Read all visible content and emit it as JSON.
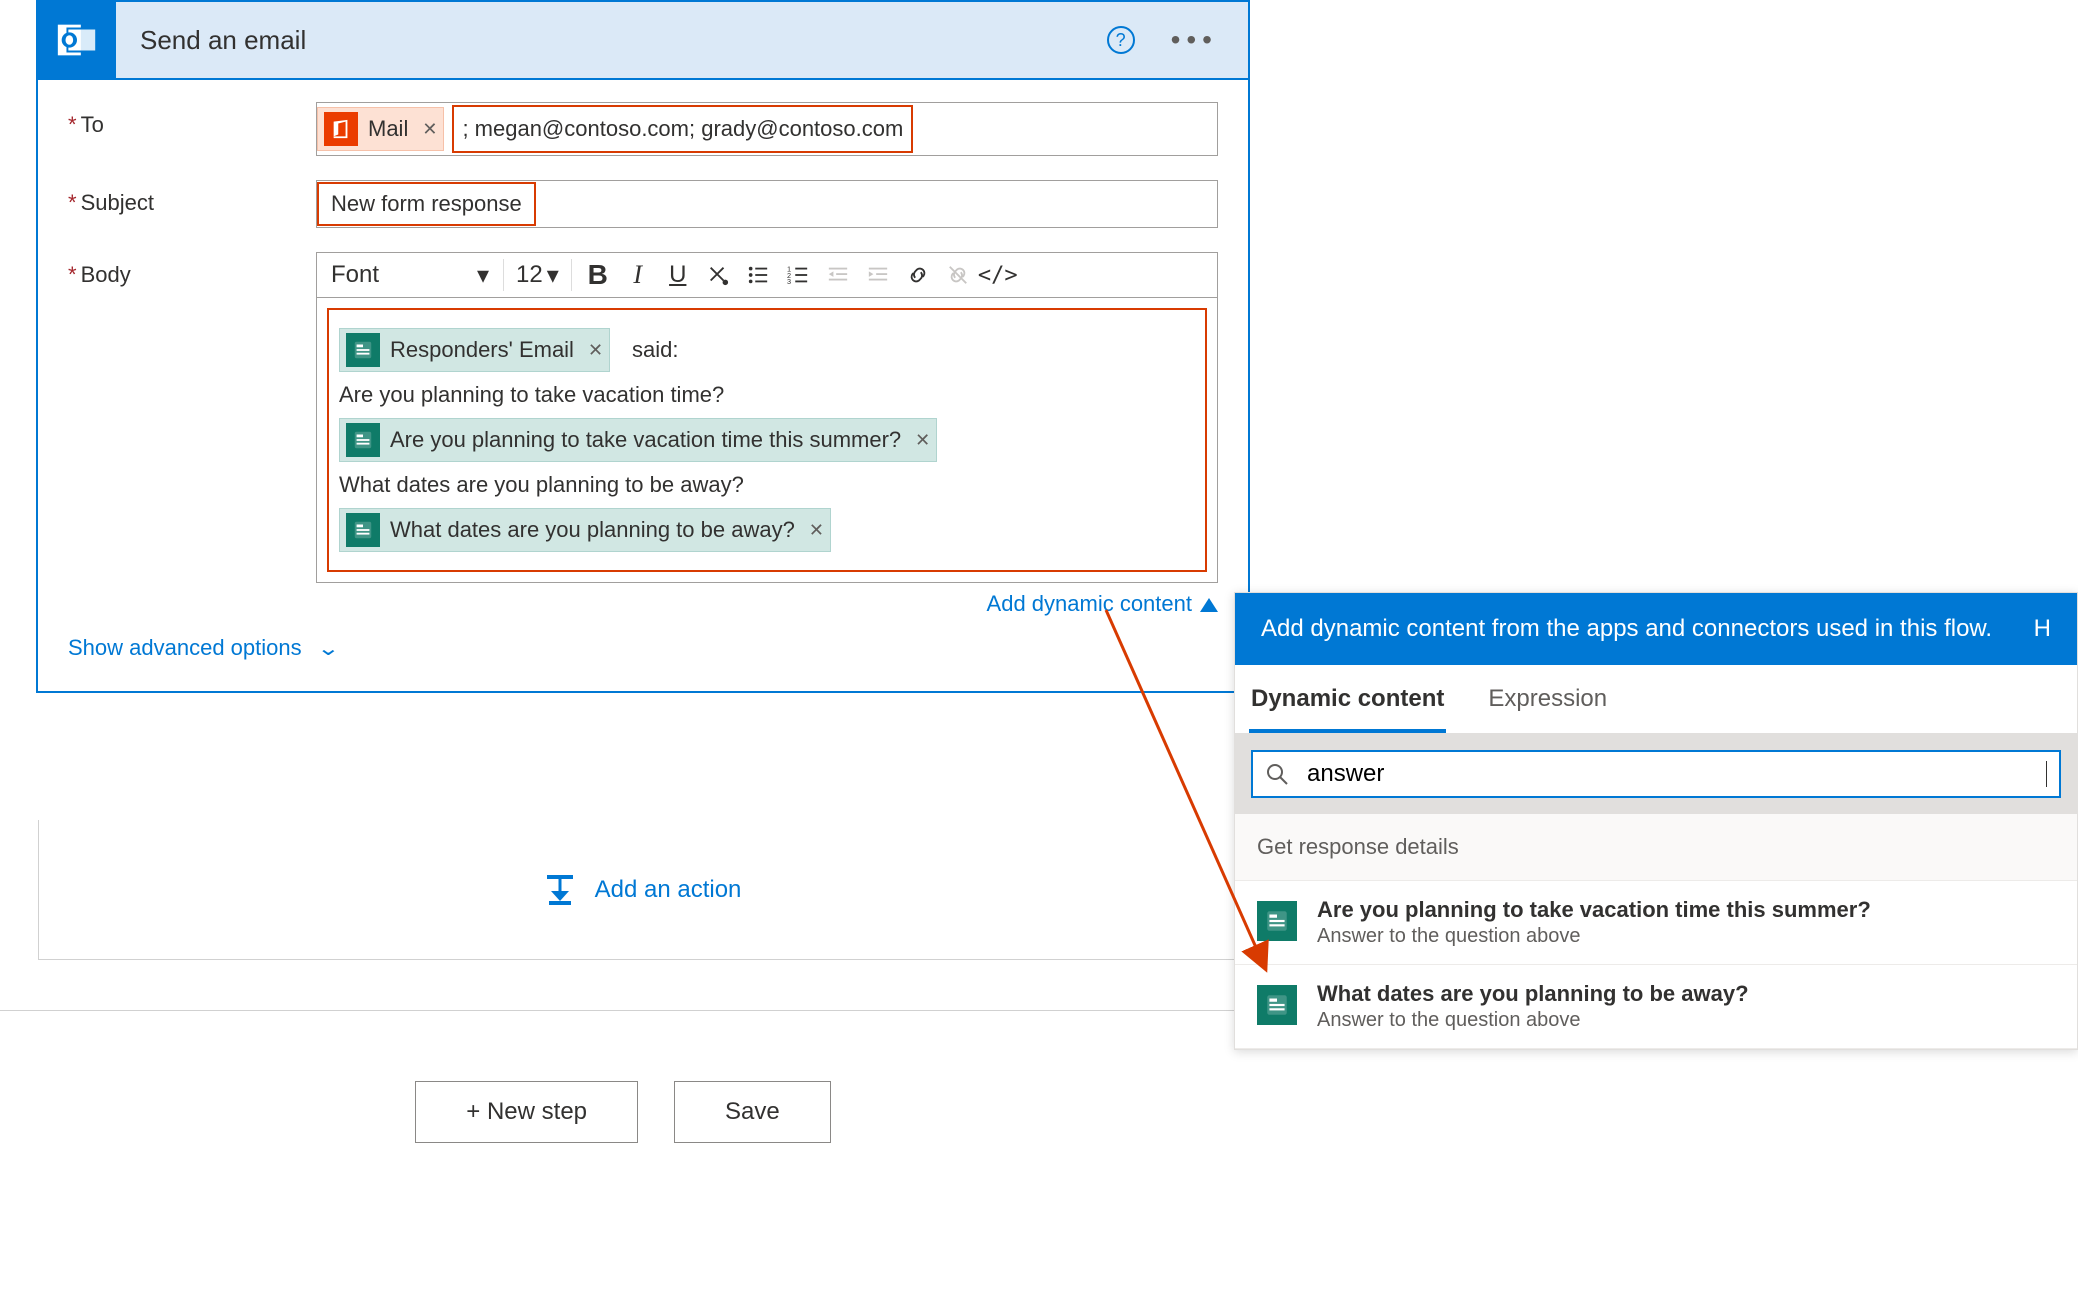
{
  "card": {
    "title": "Send an email",
    "fields": {
      "to_label": "To",
      "subject_label": "Subject",
      "body_label": "Body"
    },
    "to": {
      "token_label": "Mail",
      "rest": "; megan@contoso.com; grady@contoso.com"
    },
    "subject_value": "New form response",
    "toolbar": {
      "font": "Font",
      "size": "12"
    },
    "body": {
      "said": "said:",
      "token_responders": "Responders' Email",
      "line1": "Are you planning to take vacation time?",
      "token_q1": "Are you planning to take vacation time this summer?",
      "line2": "What dates are you planning to be away?",
      "token_q2": "What dates are you planning to be away?"
    },
    "add_dynamic": "Add dynamic content",
    "advanced": "Show advanced options"
  },
  "add_action": "Add an action",
  "buttons": {
    "new_step": "+ New step",
    "save": "Save"
  },
  "dyn": {
    "header_text": "Add dynamic content from the apps and connectors used in this flow.",
    "header_right": "H",
    "tab_dynamic": "Dynamic content",
    "tab_expression": "Expression",
    "search_value": "answer",
    "section": "Get response details",
    "items": [
      {
        "title": "Are you planning to take vacation time this summer?",
        "sub": "Answer to the question above"
      },
      {
        "title": "What dates are you planning to be away?",
        "sub": "Answer to the question above"
      }
    ]
  }
}
